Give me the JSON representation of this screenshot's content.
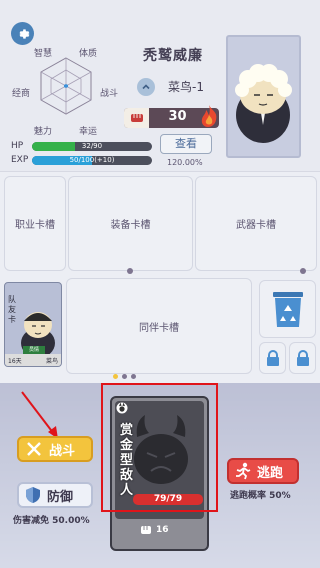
{
  "player": {
    "name": "秃鹫威廉",
    "rank": "菜鸟-1",
    "power": "30",
    "view_label": "查看",
    "percent": "120.00%",
    "hp_label": "HP",
    "hp_text": "32/90",
    "hp_fraction": 0.356,
    "exp_label": "EXP",
    "exp_text": "50/100(+10)",
    "exp_fraction": 0.5
  },
  "radar": {
    "labels": [
      "智慧",
      "体质",
      "经商",
      "战斗",
      "魅力",
      "幸运"
    ]
  },
  "slots": {
    "job": "职业卡槽",
    "equip": "装备卡槽",
    "weapon": "武器卡槽",
    "partner": "同伴卡槽"
  },
  "partner_card": {
    "tag_line1": "队",
    "tag_line2": "友",
    "tag_line3": "卡",
    "bottom_left": "16天",
    "bottom_mid": "员情",
    "bottom_right": "菜鸟"
  },
  "battle": {
    "fight_label": "战斗",
    "defend_label": "防御",
    "defense_reduction": "伤害减免 50.00%",
    "flee_label": "逃跑",
    "flee_chance": "逃跑概率 50%"
  },
  "enemy": {
    "name": "赏金型敌人",
    "hp": "79/79",
    "attack": "16"
  },
  "colors": {
    "hp": "#35b14a",
    "exp": "#2aa0d8",
    "fight": "#f3c43d",
    "flee": "#e84c47",
    "highlight": "#e0141a"
  }
}
